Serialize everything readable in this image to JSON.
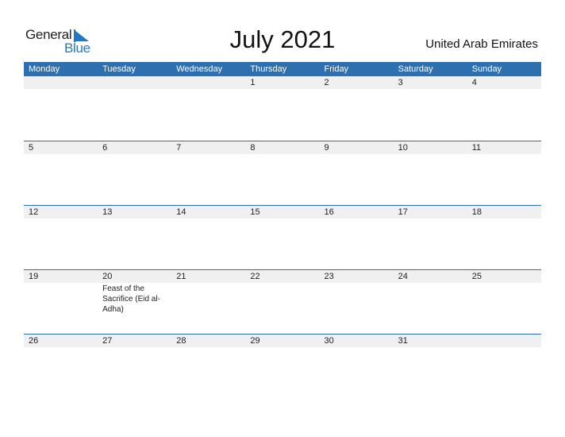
{
  "logo": {
    "word1": "General",
    "word2": "Blue"
  },
  "title": "July 2021",
  "country": "United Arab Emirates",
  "colors": {
    "header_bg": "#2e6fb0",
    "date_strip": "#f0f0f0",
    "brand_blue": "#1f78c4"
  },
  "weekdays": [
    "Monday",
    "Tuesday",
    "Wednesday",
    "Thursday",
    "Friday",
    "Saturday",
    "Sunday"
  ],
  "weeks": [
    [
      {
        "day": ""
      },
      {
        "day": ""
      },
      {
        "day": ""
      },
      {
        "day": "1"
      },
      {
        "day": "2"
      },
      {
        "day": "3"
      },
      {
        "day": "4"
      }
    ],
    [
      {
        "day": "5"
      },
      {
        "day": "6"
      },
      {
        "day": "7"
      },
      {
        "day": "8"
      },
      {
        "day": "9"
      },
      {
        "day": "10"
      },
      {
        "day": "11"
      }
    ],
    [
      {
        "day": "12"
      },
      {
        "day": "13"
      },
      {
        "day": "14"
      },
      {
        "day": "15"
      },
      {
        "day": "16"
      },
      {
        "day": "17"
      },
      {
        "day": "18"
      }
    ],
    [
      {
        "day": "19"
      },
      {
        "day": "20",
        "event": "Feast of the Sacrifice (Eid al-Adha)"
      },
      {
        "day": "21"
      },
      {
        "day": "22"
      },
      {
        "day": "23"
      },
      {
        "day": "24"
      },
      {
        "day": "25"
      }
    ],
    [
      {
        "day": "26"
      },
      {
        "day": "27"
      },
      {
        "day": "28"
      },
      {
        "day": "29"
      },
      {
        "day": "30"
      },
      {
        "day": "31"
      },
      {
        "day": ""
      }
    ]
  ]
}
